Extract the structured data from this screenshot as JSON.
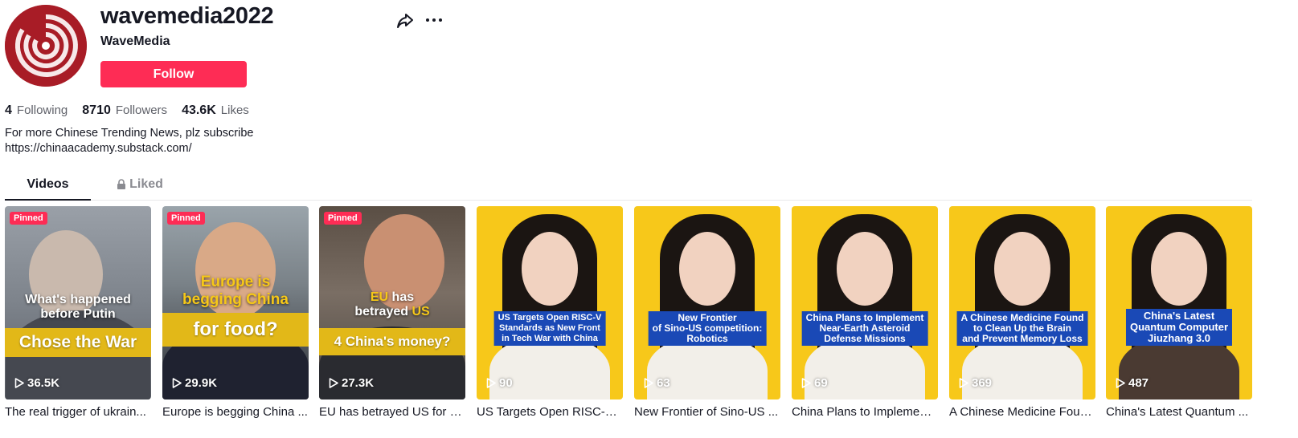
{
  "profile": {
    "username": "wavemedia2022",
    "nickname": "WaveMedia",
    "follow_label": "Follow",
    "share_icon": "share-arrow-icon",
    "more_icon": "more-dots-icon",
    "avatar_color": "#b01f2a"
  },
  "stats": {
    "following": {
      "value": "4",
      "label": "Following"
    },
    "followers": {
      "value": "8710",
      "label": "Followers"
    },
    "likes": {
      "value": "43.6K",
      "label": "Likes"
    }
  },
  "bio": {
    "line1": "For more Chinese Trending News, plz subscribe",
    "line2": "https://chinaacademy.substack.com/"
  },
  "tabs": {
    "videos": "Videos",
    "liked": "Liked"
  },
  "colors": {
    "accent": "#fe2c55",
    "overlay_blue": "#1a49b6",
    "overlay_yellow": "#e2b818",
    "thumb_yellow": "#f7c81a"
  },
  "videos": [
    {
      "pinned": "Pinned",
      "views": "36.5K",
      "caption": "The real trigger of ukrain...",
      "overlay_top": "What's happened before Putin",
      "overlay_band": "Chose the War"
    },
    {
      "pinned": "Pinned",
      "views": "29.9K",
      "caption": "Europe is begging China ...",
      "overlay_top": "Europe is begging China",
      "overlay_band": "for food?"
    },
    {
      "pinned": "Pinned",
      "views": "27.3K",
      "caption": "EU has betrayed US for C...",
      "overlay_top_a": "EU",
      "overlay_top_b": " has",
      "overlay_top_c": "betrayed ",
      "overlay_top_d": "US",
      "overlay_band": "4 China's money?"
    },
    {
      "views": "90",
      "caption": "US Targets Open RISC-V ...",
      "box_l1": "US Targets Open RISC-V",
      "box_l2": "Standards as New Front",
      "box_l3": "in Tech War with China"
    },
    {
      "views": "63",
      "caption": "New Frontier of Sino-US ...",
      "box_l1": "New Frontier",
      "box_l2": "of Sino-US competition:",
      "box_l3": "Robotics"
    },
    {
      "views": "69",
      "caption": "China Plans to Implement...",
      "box_l1": "China Plans to Implement",
      "box_l2": "Near-Earth Asteroid",
      "box_l3": "Defense Missions"
    },
    {
      "views": "369",
      "caption": "A Chinese Medicine Foun...",
      "box_l1": "A Chinese Medicine Found",
      "box_l2": "to Clean Up the Brain",
      "box_l3": "and Prevent Memory Loss"
    },
    {
      "views": "487",
      "caption": "China's Latest Quantum ...",
      "box_l1": "China's Latest",
      "box_l2": "Quantum Computer",
      "box_l3": "Jiuzhang 3.0"
    }
  ]
}
